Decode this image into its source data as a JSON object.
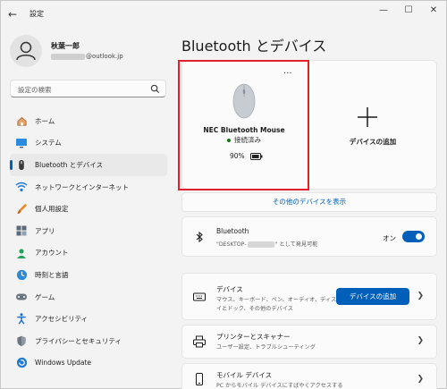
{
  "window": {
    "title": "設定",
    "back": "←",
    "minimize": "—",
    "maximize": "☐",
    "close": "✕"
  },
  "profile": {
    "name": "秋葉一郎",
    "email_suffix": "@outlook.jp"
  },
  "search": {
    "placeholder": "設定の検索"
  },
  "nav": {
    "items": [
      {
        "label": "ホーム",
        "icon": "home-icon",
        "active": false
      },
      {
        "label": "システム",
        "icon": "system-icon",
        "active": false
      },
      {
        "label": "Bluetooth とデバイス",
        "icon": "bluetooth-icon",
        "active": true
      },
      {
        "label": "ネットワークとインターネット",
        "icon": "network-icon",
        "active": false
      },
      {
        "label": "個人用設定",
        "icon": "personalization-icon",
        "active": false
      },
      {
        "label": "アプリ",
        "icon": "apps-icon",
        "active": false
      },
      {
        "label": "アカウント",
        "icon": "account-icon",
        "active": false
      },
      {
        "label": "時刻と言語",
        "icon": "time-language-icon",
        "active": false
      },
      {
        "label": "ゲーム",
        "icon": "gaming-icon",
        "active": false
      },
      {
        "label": "アクセシビリティ",
        "icon": "accessibility-icon",
        "active": false
      },
      {
        "label": "プライバシーとセキュリティ",
        "icon": "privacy-icon",
        "active": false
      },
      {
        "label": "Windows Update",
        "icon": "windows-update-icon",
        "active": false
      }
    ]
  },
  "main": {
    "title": "Bluetooth とデバイス",
    "device": {
      "name": "NEC Bluetooth Mouse",
      "status": "接続済み",
      "battery": "90%",
      "more": "···"
    },
    "add_device_label": "デバイスの追加",
    "show_more": "その他のデバイスを表示",
    "bluetooth": {
      "title": "Bluetooth",
      "sub_prefix": "\"DESKTOP-",
      "sub_suffix": "\" として発見可能",
      "toggle_label": "オン",
      "on": true
    },
    "devices_row": {
      "title": "デバイス",
      "sub1": "マウス、キーボード、ペン、オーディオ、ディスプレ",
      "sub2": "イとドック、その他のデバイス",
      "button": "デバイスの追加"
    },
    "printers_row": {
      "title": "プリンターとスキャナー",
      "sub": "ユーザー設定、トラブルシューティング"
    },
    "mobile_row": {
      "title": "モバイル デバイス",
      "sub": "PC からモバイル デバイスにすばやくアクセスする"
    }
  },
  "colors": {
    "accent": "#005fb8",
    "highlight": "#e0202b",
    "connected": "#0f7b0f"
  }
}
